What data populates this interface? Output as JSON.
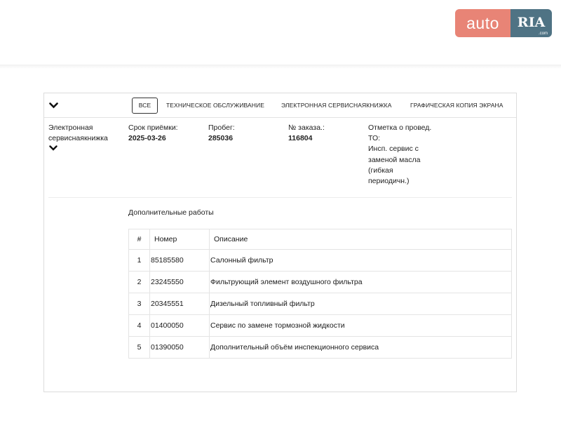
{
  "watermark": {
    "part1": "auto",
    "part2": "RIA",
    "suffix": ".com"
  },
  "tabs": {
    "all": "ВСЕ",
    "maintenance": "ТЕХНИЧЕСКОЕ ОБСЛУЖИВАНИЕ",
    "ebook": "ЭЛЕКТРОННАЯ СЕРВИСНАЯКНИЖКА",
    "screenshot": "ГРАФИЧЕСКАЯ КОПИЯ ЭКРАНА"
  },
  "record": {
    "type_line1": "Электронная",
    "type_line2": "сервиснаякнижка",
    "date_label": "Срок приёмки:",
    "date_value": "2025-03-26",
    "mileage_label": "Пробег:",
    "mileage_value": "285036",
    "order_label": "№ заказа.:",
    "order_value": "116804",
    "note_lines": [
      "Отметка о провед.",
      "ТО:",
      "Инсп. сервис с",
      "заменой масла",
      "(гибкая",
      "периодичн.)"
    ]
  },
  "extra_works": {
    "title": "Дополнительные работы",
    "columns": [
      "#",
      "Номер",
      "Описание"
    ],
    "rows": [
      {
        "n": "1",
        "part": "85185580",
        "desc": "Салонный фильтр"
      },
      {
        "n": "2",
        "part": "23245550",
        "desc": "Фильтрующий элемент воздушного фильтра"
      },
      {
        "n": "3",
        "part": "20345551",
        "desc": "Дизельный топливный фильтр"
      },
      {
        "n": "4",
        "part": "01400050",
        "desc": "Сервис по замене тормозной жидкости"
      },
      {
        "n": "5",
        "part": "01390050",
        "desc": "Дополнительный объём инспекционного сервиса"
      }
    ]
  }
}
